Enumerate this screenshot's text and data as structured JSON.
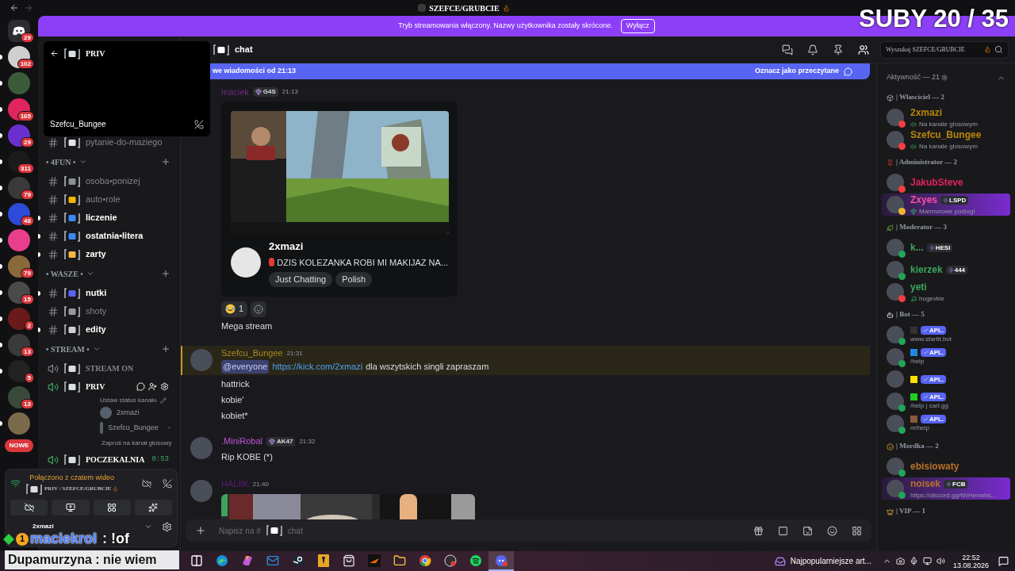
{
  "titlebar": {
    "title": "SZEFCE/GRUBCIE"
  },
  "overlay_counter": "SUBY 20 / 35",
  "overlay_chat": [
    {
      "rank": "1",
      "user": "maciekrol",
      "message": " : !of"
    },
    {
      "user": "Dupamurzyna",
      "message": " : nie wiem"
    }
  ],
  "banner": {
    "text": "Tryb streamowania włączony. Nazwy użytkownika zostały skrócone.",
    "button": "Wyłącz"
  },
  "servers": [
    {
      "kind": "home",
      "badge": "29",
      "unread": false
    },
    {
      "color": "#cfcfcf",
      "badge": "102",
      "unread": true
    },
    {
      "color": "#3b5a3a",
      "unread": true
    },
    {
      "color": "#e0245e",
      "badge": "165",
      "unread": true
    },
    {
      "color": "#6b2fd0",
      "badge": "29",
      "unread": true
    },
    {
      "color": "#1b1b1b",
      "badge": "311",
      "unread": true
    },
    {
      "color": "#3a3a3a",
      "badge": "79",
      "unread": true
    },
    {
      "color": "#2b4bd8",
      "badge": "48",
      "unread": true
    },
    {
      "color": "#e83e8c",
      "unread": true
    },
    {
      "color": "#8a6a3a",
      "badge": "79",
      "unread": true
    },
    {
      "color": "#4a4a4a",
      "badge": "15",
      "unread": true
    },
    {
      "color": "#6a1a1a",
      "badge": "2",
      "unread": true
    },
    {
      "color": "#3a3a3a",
      "badge": "13",
      "unread": true
    },
    {
      "color": "#222222",
      "badge": "5",
      "unread": true
    },
    {
      "color": "#3a4a3a",
      "badge": "13",
      "unread": false
    },
    {
      "color": "#7a6a4a",
      "unread": true
    }
  ],
  "rail_notice": "NOWE",
  "video_popup": {
    "channel": "PRIV",
    "user": "Szefcu_Bungee"
  },
  "channel_list": [
    {
      "kind": "text",
      "name": "pytanie-do-maziego",
      "unread": false,
      "color": "#e3e5e8"
    },
    {
      "kind": "category",
      "name": "• 4FUN •"
    },
    {
      "kind": "text",
      "name": "osoba•ponizej",
      "unread": false,
      "color": "#8a8e94"
    },
    {
      "kind": "text",
      "name": "auto•role",
      "unread": false,
      "color": "#f4b400"
    },
    {
      "kind": "text",
      "name": "liczenie",
      "unread": true,
      "color": "#3b88f5"
    },
    {
      "kind": "text",
      "name": "ostatnia•litera",
      "unread": true,
      "color": "#3b88f5"
    },
    {
      "kind": "text",
      "name": "zarty",
      "unread": true,
      "color": "#f5b642"
    },
    {
      "kind": "category",
      "name": "• WASZE •"
    },
    {
      "kind": "text",
      "name": "nutki",
      "unread": true,
      "color": "#5865f2"
    },
    {
      "kind": "text",
      "name": "shoty",
      "unread": false,
      "color": "#9a9a9a"
    },
    {
      "kind": "text",
      "name": "edity",
      "unread": true,
      "color": "#d0d0d0"
    },
    {
      "kind": "category",
      "name": "• STREAM •"
    },
    {
      "kind": "voice",
      "name": "STREAM ON",
      "active": false,
      "controls": false
    },
    {
      "kind": "voice",
      "name": "PRIV",
      "active": true,
      "controls": true
    },
    {
      "kind": "status",
      "text": "Ustaw status kanału"
    },
    {
      "kind": "member",
      "name": "2xmazi",
      "camera": false
    },
    {
      "kind": "member",
      "name": "Szefcu_Bungee",
      "camera": true
    },
    {
      "kind": "invite",
      "text": "Zaproś na kanał głosowy"
    },
    {
      "kind": "voice",
      "name": "POCZEKALNIA",
      "active": true,
      "controls": false,
      "timer": "0:53"
    }
  ],
  "voice_panel": {
    "status": "Połączono z czatem wideo",
    "channel": "PRIV / SZEFCE/GRUBCIE"
  },
  "user_panel": {
    "name": "2xmazi"
  },
  "chat": {
    "channel": "chat",
    "search_placeholder": "Wyszukaj SZEFCE/GRUBCIE"
  },
  "new_messages": {
    "text": "we wiadomości od 21:13",
    "action": "Oznacz jako przeczytane"
  },
  "messages": [
    {
      "author": "maciek",
      "color": "#6e2a84",
      "avatar": false,
      "badge": "G4S",
      "time": "21:13",
      "mention": false,
      "content": [
        {
          "kind": "embed",
          "channel": "2xmazi",
          "title": "DZIS KOLEZANKA ROBI MI MAKIJAZ NA...",
          "tags": [
            "Just Chatting",
            "Polish"
          ]
        },
        {
          "kind": "reaction",
          "count": "1"
        },
        {
          "kind": "line",
          "text": "Mega stream"
        }
      ]
    },
    {
      "author": "Szefcu_Bungee",
      "color": "#a88a1e",
      "avatar": true,
      "time": "21:31",
      "mention": true,
      "content": [
        {
          "kind": "mention_line",
          "mention": "@everyone",
          "link": "https://kick.com/2xmazi",
          "text": "dla wszytskich singli zapraszam"
        },
        {
          "kind": "line",
          "text": "hattrick"
        },
        {
          "kind": "line",
          "text": "kobie'"
        },
        {
          "kind": "line",
          "text": "kobiet*"
        }
      ]
    },
    {
      "author": ".MiniRobal",
      "color": "#c054e0",
      "avatar": true,
      "badge": "AK47",
      "time": "21:32",
      "mention": false,
      "content": [
        {
          "kind": "line",
          "text": "Rip KOBE (*)"
        }
      ]
    },
    {
      "author": "HALIIK",
      "color": "#5a1a78",
      "avatar": true,
      "time": "21:40",
      "mention": false
    }
  ],
  "composer": {
    "hint": "Napisz na #",
    "channel": "chat"
  },
  "members": {
    "title": "Aktywność — 21",
    "groups": [
      {
        "kind": "box",
        "title": "| Wlasciciel — 2",
        "members": [
          {
            "name": "2xmazi",
            "color": "#b8860b",
            "status": {
              "color": "#f23f43"
            },
            "activity": {
              "kind": "voice",
              "text": "Na kanale glosowym"
            }
          },
          {
            "name": "Szefcu_Bungee",
            "color": "#b8860b",
            "status": {
              "color": "#f23f43"
            },
            "activity": {
              "kind": "voice",
              "text": "Na kanale glosowym"
            }
          }
        ]
      },
      {
        "kind": "pin",
        "title": "| Administrator — 2",
        "members": [
          {
            "name": "JakubSteve",
            "color": "#e0245e",
            "status": {
              "color": "#f23f43"
            }
          },
          {
            "name": "Zxyes",
            "color": "#ff4fa3",
            "status": {
              "color": "#f0b232"
            },
            "tag": "LSPD",
            "activity": {
              "kind": "bag",
              "text": "Marmurowe podlogi"
            },
            "highlight": true
          }
        ]
      },
      {
        "kind": "shield",
        "title": "| Moderator — 3",
        "members": [
          {
            "name": "k...",
            "color": "#3ba55d",
            "status": {
              "color": "#23a55a"
            },
            "tag": "HESI"
          },
          {
            "name": "kierzek",
            "color": "#3ba55d",
            "status": {
              "color": "#23a55a"
            },
            "tag": "444"
          },
          {
            "name": "yeti",
            "color": "#3ba55d",
            "status": {
              "color": "#f23f43"
            },
            "activity": {
              "kind": "music",
              "text": "hugevkie"
            }
          }
        ]
      },
      {
        "kind": "bot",
        "title": "| Bot — 5",
        "members": [
          {
            "kind": "bot",
            "name_emoji": {
              "color": "#333333"
            },
            "status": {
              "color": "#23a55a"
            },
            "tag": "APL.",
            "activity": {
              "kind": "plain",
              "text": "www.startit.bot"
            }
          },
          {
            "kind": "bot",
            "name_emoji": {
              "color": "#1e88e5"
            },
            "status": {
              "color": "#23a55a"
            },
            "tag": "APL.",
            "activity": {
              "kind": "plain",
              "text": "/help"
            }
          },
          {
            "kind": "bot",
            "name_emoji": {
              "color": "#ffe100"
            },
            "tag": "APL."
          },
          {
            "kind": "bot",
            "name_emoji": {
              "color": "#22cc22"
            },
            "status": {
              "color": "#23a55a"
            },
            "tag": "APL.",
            "activity": {
              "kind": "plain",
              "text": "/help | carl.gg"
            }
          },
          {
            "kind": "bot",
            "name_emoji": {
              "color": "#8a5a3a"
            },
            "status": {
              "color": "#23a55a"
            },
            "tag": "APL.",
            "activity": {
              "kind": "plain",
              "text": "m!help"
            }
          }
        ]
      },
      {
        "kind": "bear",
        "title": "| Mordka — 2",
        "members": [
          {
            "name": "ebisiowaty",
            "color": "#b8722b",
            "status": {
              "color": "#23a55a"
            }
          },
          {
            "name": "noisek",
            "color": "#b8722b",
            "status": {
              "color": "#23a55a"
            },
            "tag": "FCB",
            "activity": {
              "kind": "plain",
              "text": "https://discord.gg/tWHenwhs..."
            },
            "highlight": true
          }
        ]
      },
      {
        "kind": "crown",
        "title": "| VIP — 1"
      }
    ]
  },
  "taskbar": {
    "apps": [
      {
        "kind": "taskview",
        "selected": false
      },
      {
        "kind": "edge",
        "selected": false
      },
      {
        "kind": "copilot",
        "selected": false
      },
      {
        "kind": "mail",
        "selected": false
      },
      {
        "kind": "steam",
        "selected": false
      },
      {
        "kind": "game",
        "selected": false
      },
      {
        "kind": "store",
        "selected": false
      },
      {
        "kind": "tool",
        "selected": false
      },
      {
        "kind": "folder",
        "selected": false
      },
      {
        "kind": "chrome",
        "selected": false
      },
      {
        "kind": "obs",
        "selected": false
      },
      {
        "kind": "spotify",
        "selected": false
      },
      {
        "kind": "discord",
        "selected": true
      }
    ],
    "news": "Najpopularniejsze art...",
    "time": "22:52",
    "date": "13.08.2026"
  }
}
